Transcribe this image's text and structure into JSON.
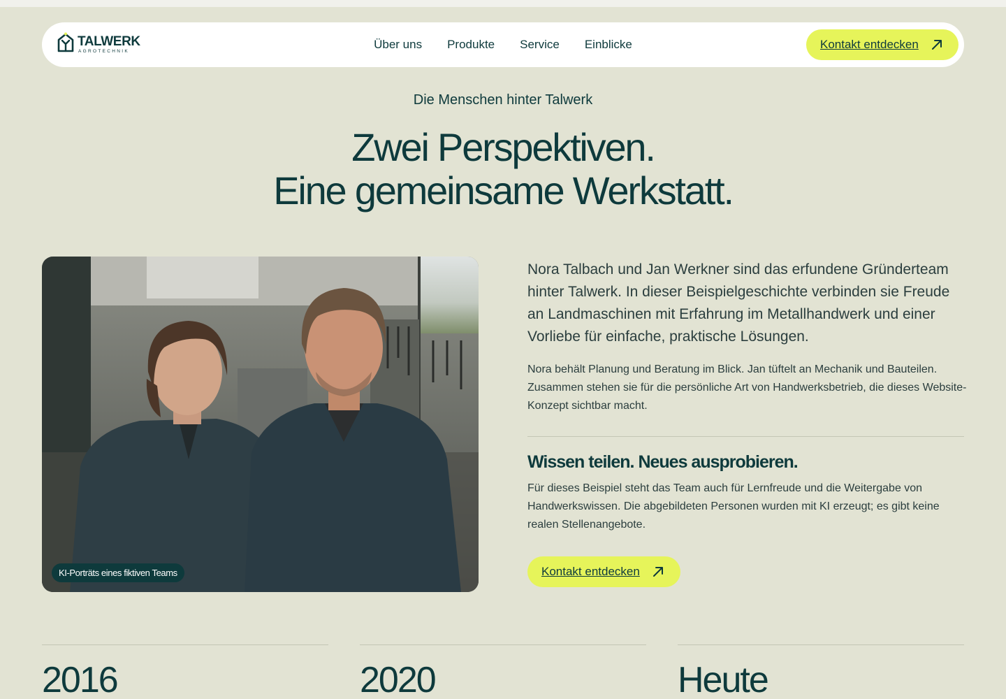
{
  "nav": {
    "logo_word": "TALWERK",
    "logo_sub": "AGROTECHNIK",
    "links": [
      "Über uns",
      "Produkte",
      "Service",
      "Einblicke"
    ],
    "cta_label": "Kontakt entdecken"
  },
  "hero": {
    "eyebrow": "Die Menschen hinter Talwerk",
    "headline_line1": "Zwei Perspektiven.",
    "headline_line2": "Eine gemeinsame Werkstatt."
  },
  "photo": {
    "caption": "KI-Porträts eines fiktiven Teams"
  },
  "story": {
    "lead": "Nora Talbach und Jan Werkner sind das erfundene Gründerteam hinter Talwerk. In dieser Beispielgeschichte verbinden sie Freude an Landmaschinen mit Erfahrung im Metallhandwerk und einer Vorliebe für einfache, praktische Lösungen.",
    "body": "Nora behält Planung und Beratung im Blick. Jan tüftelt an Mechanik und Bauteilen. Zusammen stehen sie für die persönliche Art von Handwerksbetrieb, die dieses Website-Konzept sichtbar macht.",
    "subheading": "Wissen teilen. Neues ausprobieren.",
    "body2": "Für dieses Beispiel steht das Team auch für Lernfreude und die Weitergabe von Handwerkswissen. Die abgebildeten Personen wurden mit KI erzeugt; es gibt keine realen Stellenangebote.",
    "cta_label": "Kontakt entdecken"
  },
  "timeline": [
    "2016",
    "2020",
    "Heute"
  ],
  "colors": {
    "accent": "#e6f45a",
    "ink": "#0e3a3c",
    "background": "#e2e3d3"
  }
}
